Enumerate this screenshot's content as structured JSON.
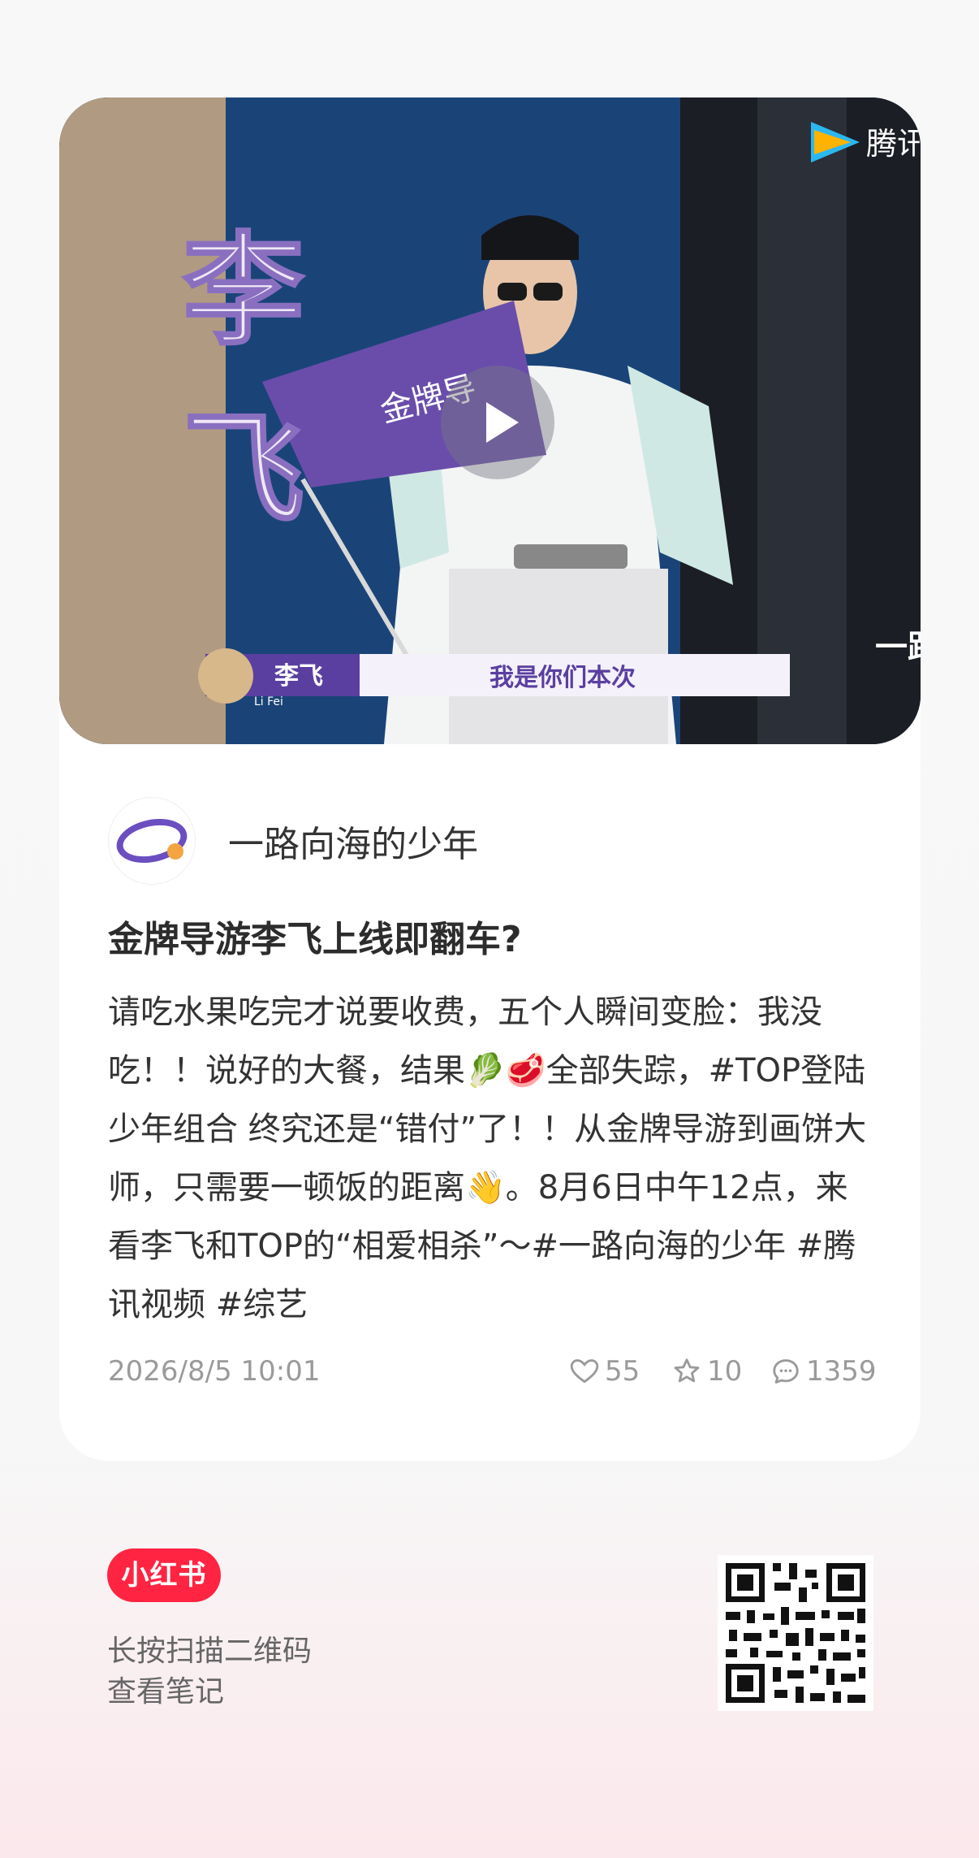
{
  "cover": {
    "name_overlay": "李\n飞",
    "channel_logo_text": "腾讯",
    "banner_name": "李飞",
    "banner_pinyin": "Li Fei",
    "banner_subtitle": "我是你们本次",
    "flag_text": "金牌导",
    "corner_text": "一路的"
  },
  "author": {
    "name": "一路向海的少年",
    "avatar_text": "一路向海的少年"
  },
  "note": {
    "title": "金牌导游李飞上线即翻车?",
    "body_parts": [
      "请吃水果吃完才说要收费，五个人瞬间变脸：我没吃！！说好的大餐，结果🥬🥩全部失踪，",
      "#TOP登陆少年组合",
      "  终究还是“错付”了！！从金牌导游到画饼大师，只需要一顿饭的距离👋。8月6日中午12点，来看李飞和TOP的“相爱相杀”～",
      "#一路向海的少年",
      "  ",
      "#腾讯视频",
      "  ",
      "#综艺"
    ]
  },
  "meta": {
    "date": "2026/8/5 10:01",
    "likes": "55",
    "collects": "10",
    "comments": "1359"
  },
  "footer": {
    "logo": "小红书",
    "line1": "长按扫描二维码",
    "line2": "查看笔记"
  },
  "colors": {
    "brand": "#ff2442",
    "muted": "#9a9a9a"
  },
  "icons": [
    "play-icon",
    "heart-icon",
    "star-icon",
    "comment-icon",
    "qr-code"
  ]
}
